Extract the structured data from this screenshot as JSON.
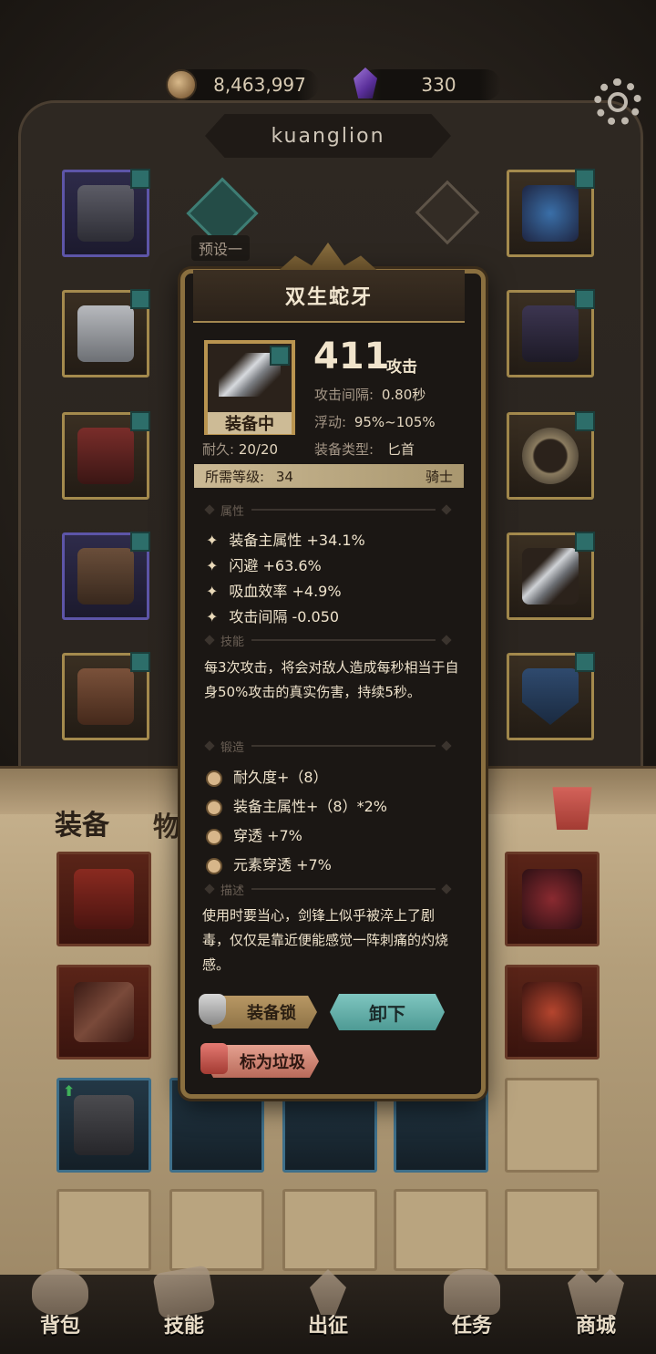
{
  "currency": {
    "gold": "8,463,997",
    "gems": "330"
  },
  "player": {
    "name": "kuanglion"
  },
  "presets": {
    "active_label": "预设一"
  },
  "bag": {
    "tabs": [
      "装备",
      "物品"
    ]
  },
  "item": {
    "name": "双生蛇牙",
    "attack_value": "411",
    "attack_label": "攻击",
    "equipped_tag": "装备中",
    "durability_label": "耐久:",
    "durability": "20/20",
    "stats": [
      {
        "label": "攻击间隔:",
        "value": "0.80秒"
      },
      {
        "label": "浮动:",
        "value": "95%~105%"
      },
      {
        "label": "装备类型:",
        "value": "匕首"
      }
    ],
    "required_level_label": "所需等级:",
    "required_level": "34",
    "class": "骑士",
    "sections": {
      "attributes": "属性",
      "skill": "技能",
      "forge": "锻造",
      "description": "描述"
    },
    "attributes": [
      "装备主属性 +34.1%",
      "闪避 +63.6%",
      "吸血效率 +4.9%",
      "攻击间隔 -0.050"
    ],
    "skill_text": "每3次攻击，将会对敌人造成每秒相当于自身50%攻击的真实伤害，持续5秒。",
    "forge": [
      "耐久度+（8）",
      "装备主属性+（8）*2%",
      "穿透 +7%",
      "元素穿透 +7%"
    ],
    "description_text": "使用时要当心，剑锋上似乎被淬上了剧毒，仅仅是靠近便能感觉一阵刺痛的灼烧感。",
    "buttons": {
      "lock": "装备锁",
      "unequip": "卸下",
      "mark_trash": "标为垃圾"
    }
  },
  "nav": [
    "背包",
    "技能",
    "出征",
    "任务",
    "商城"
  ],
  "colors": {
    "popup_border": "#8a6f3f",
    "unequip_button": "#7fc6c0",
    "trash_button": "#e5a190",
    "lock_button": "#b89864"
  }
}
